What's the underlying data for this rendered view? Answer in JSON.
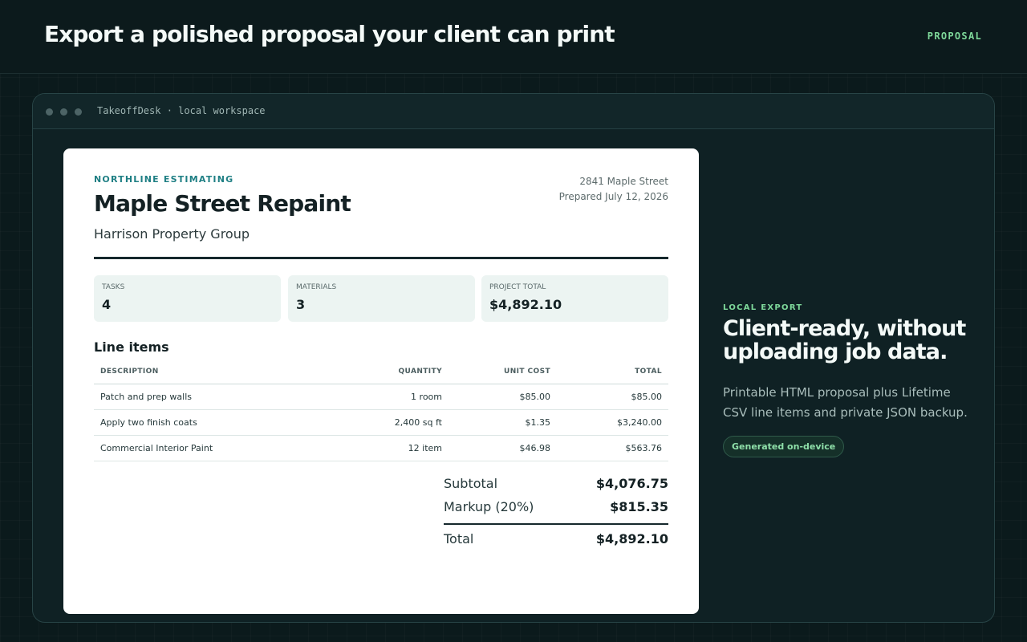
{
  "header": {
    "headline": "Export a polished proposal your client can print",
    "tag": "PROPOSAL"
  },
  "window": {
    "title": "TakeoffDesk · local workspace"
  },
  "proposal": {
    "company": "NORTHLINE ESTIMATING",
    "project_title": "Maple Street Repaint",
    "client": "Harrison Property Group",
    "address": "2841 Maple Street",
    "prepared": "Prepared July 12, 2026",
    "stats": [
      {
        "label": "TASKS",
        "value": "4"
      },
      {
        "label": "MATERIALS",
        "value": "3"
      },
      {
        "label": "PROJECT TOTAL",
        "value": "$4,892.10"
      }
    ],
    "line_items_title": "Line items",
    "columns": {
      "description": "DESCRIPTION",
      "quantity": "QUANTITY",
      "unit_cost": "UNIT COST",
      "total": "TOTAL"
    },
    "rows": [
      {
        "description": "Patch and prep walls",
        "quantity": "1 room",
        "unit_cost": "$85.00",
        "total": "$85.00"
      },
      {
        "description": "Apply two finish coats",
        "quantity": "2,400 sq ft",
        "unit_cost": "$1.35",
        "total": "$3,240.00"
      },
      {
        "description": "Commercial Interior Paint",
        "quantity": "12 item",
        "unit_cost": "$46.98",
        "total": "$563.76"
      }
    ],
    "totals": {
      "subtotal_label": "Subtotal",
      "subtotal": "$4,076.75",
      "markup_label": "Markup (20%)",
      "markup": "$815.35",
      "total_label": "Total",
      "total": "$4,892.10"
    }
  },
  "side": {
    "tag": "LOCAL EXPORT",
    "title": "Client-ready, without uploading job data.",
    "body": "Printable HTML proposal plus Lifetime CSV line items and private JSON backup.",
    "badge": "Generated on-device"
  }
}
